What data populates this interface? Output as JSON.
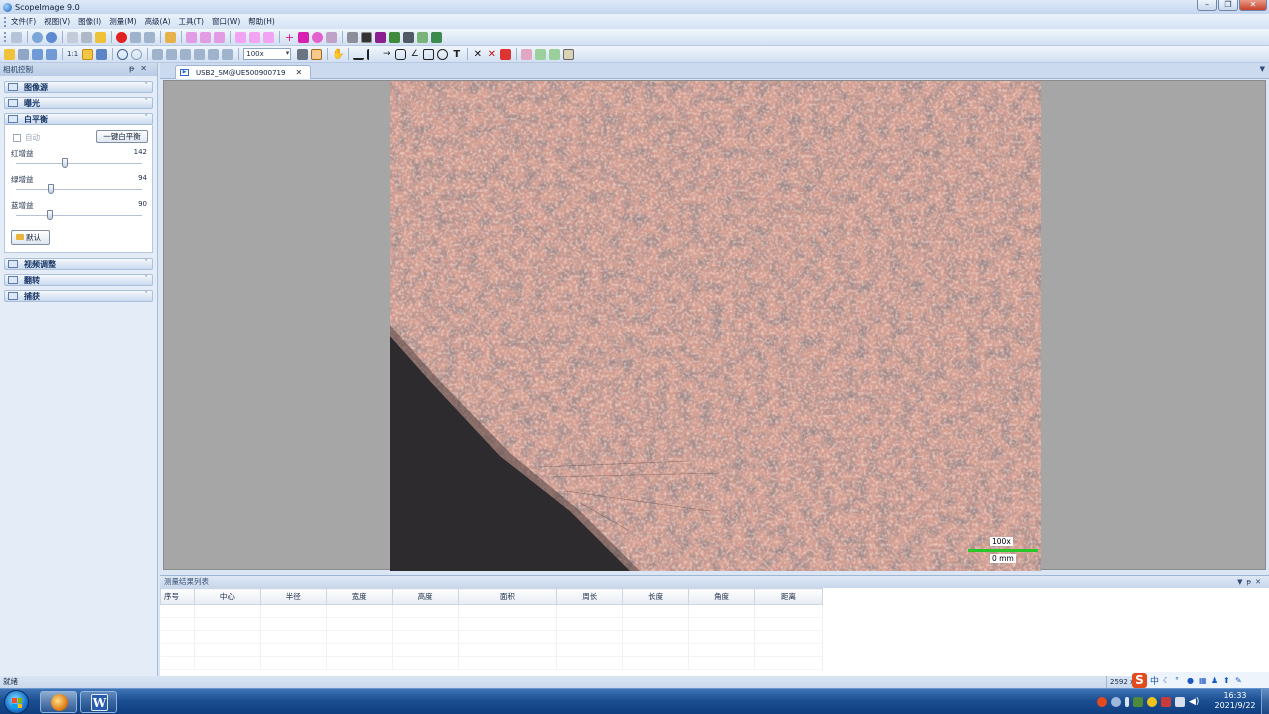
{
  "window": {
    "title": "ScopeImage 9.0",
    "minimize": "–",
    "maximize": "❐",
    "close": "✕"
  },
  "menu": [
    "文件(F)",
    "视图(V)",
    "图像(I)",
    "测量(M)",
    "高级(A)",
    "工具(T)",
    "窗口(W)",
    "帮助(H)"
  ],
  "toolbar": {
    "ratio": "1:1",
    "zoom": "100x"
  },
  "left_panel": {
    "title": "相机控制",
    "pin": "ᵽ",
    "close": "✕",
    "sections": {
      "image_source": "图像源",
      "exposure": "曝光",
      "white_balance": "白平衡",
      "video_adjust": "视频调整",
      "flip": "翻转",
      "capture": "捕获"
    },
    "white_balance": {
      "auto_label": "自动",
      "auto_checked": false,
      "one_key_button": "一键白平衡",
      "red_label": "红增益",
      "red_value": "142",
      "green_label": "绿增益",
      "green_value": "94",
      "blue_label": "蓝增益",
      "blue_value": "90",
      "red_level": 0.39,
      "green_level": 0.27,
      "blue_level": 0.26,
      "default_button": "默认"
    }
  },
  "document_tab": {
    "title": "USB2_SM@UE500900719",
    "close": "✕"
  },
  "viewer": {
    "scale_magnification": "100x",
    "scale_length": "0 mm"
  },
  "results": {
    "title": "测量结果列表",
    "columns": [
      "序号",
      "中心",
      "半径",
      "宽度",
      "高度",
      "面积",
      "周长",
      "长度",
      "角度",
      "距离"
    ]
  },
  "status": {
    "text": "就绪",
    "coords": "2592 x 1"
  },
  "ime": {
    "mode": "中"
  },
  "clock": {
    "time": "16:33",
    "date": "2021/9/22"
  },
  "colors": {
    "accent": "#1d56c7",
    "micro_bg": "#c9968a",
    "scale_bar": "#28c628"
  }
}
